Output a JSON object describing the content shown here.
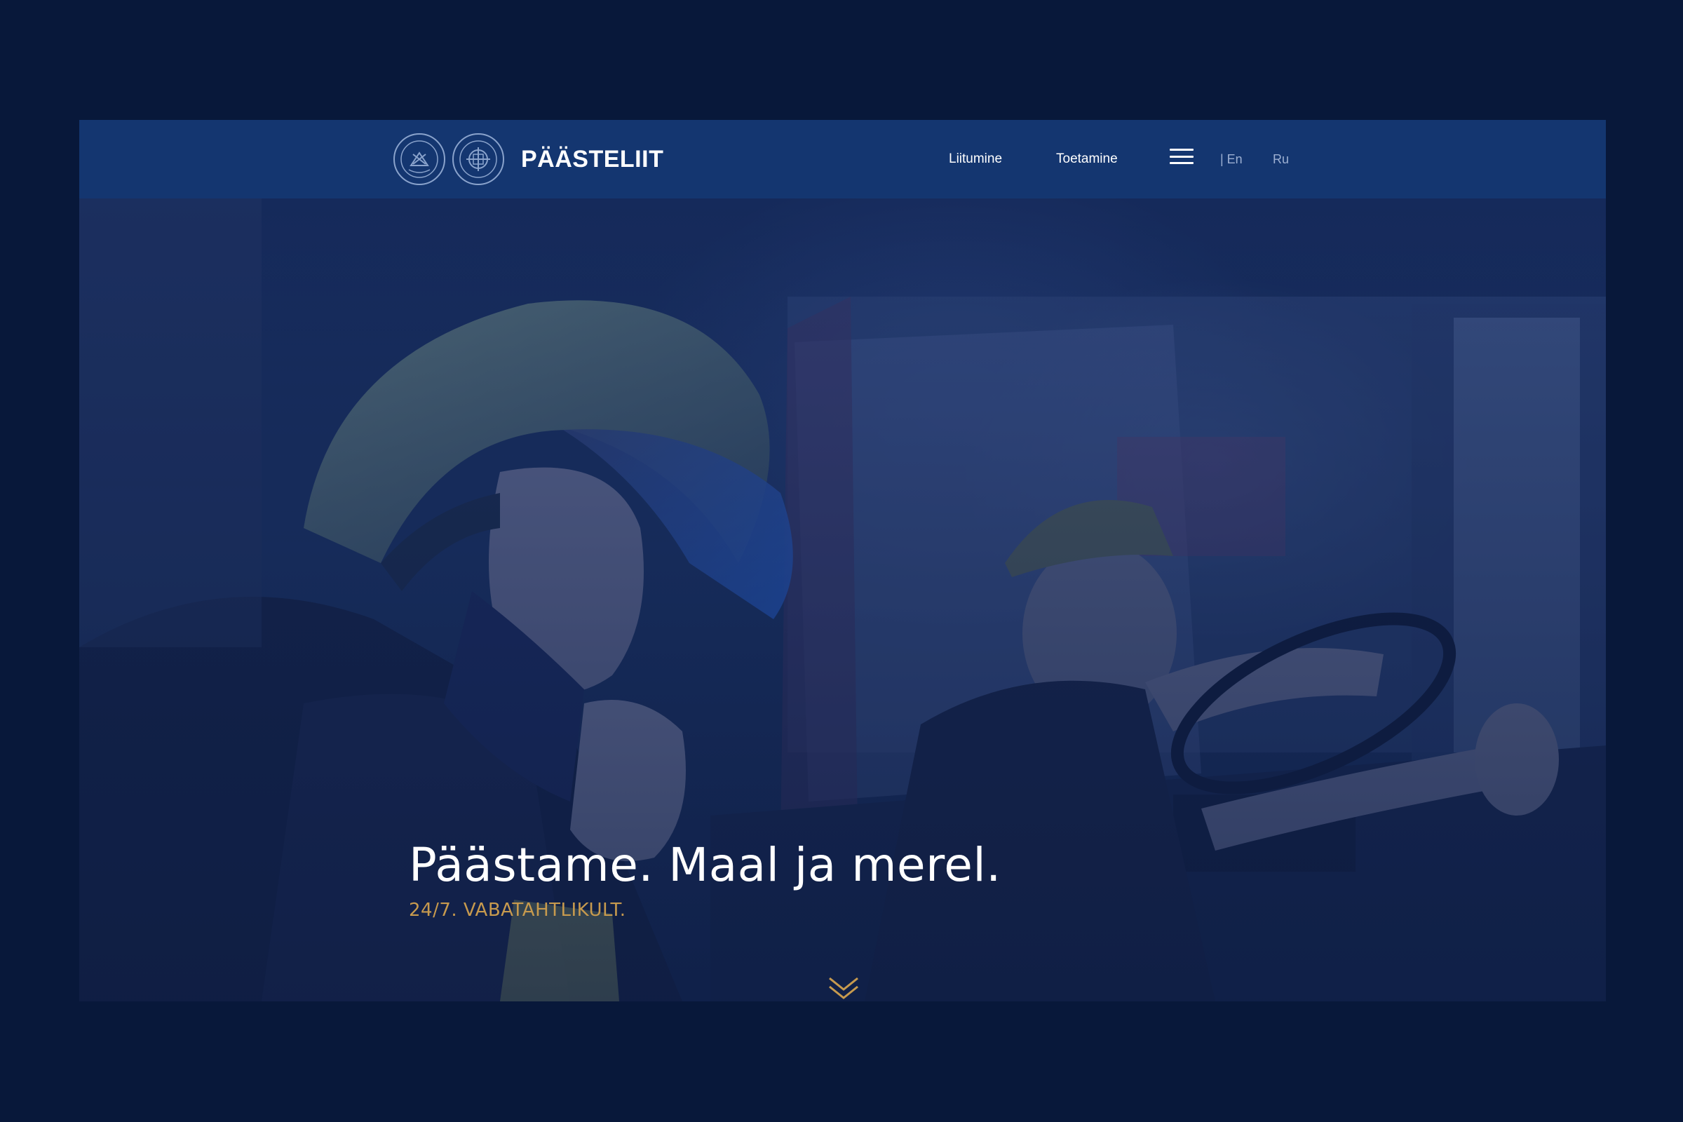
{
  "header": {
    "brand": "PÄÄSTELIIT",
    "nav": [
      {
        "label": "Liitumine"
      },
      {
        "label": "Toetamine"
      }
    ],
    "menu_icon": "hamburger-menu-icon",
    "languages": [
      "| En",
      "Ru"
    ]
  },
  "hero": {
    "title": "Päästame. Maal ja merel.",
    "subtitle": "24/7. VABATAHTLIKULT.",
    "scroll_icon": "chevron-double-down-icon"
  },
  "colors": {
    "background": "#08183a",
    "header": "#143670",
    "accent": "#c79a4e"
  }
}
